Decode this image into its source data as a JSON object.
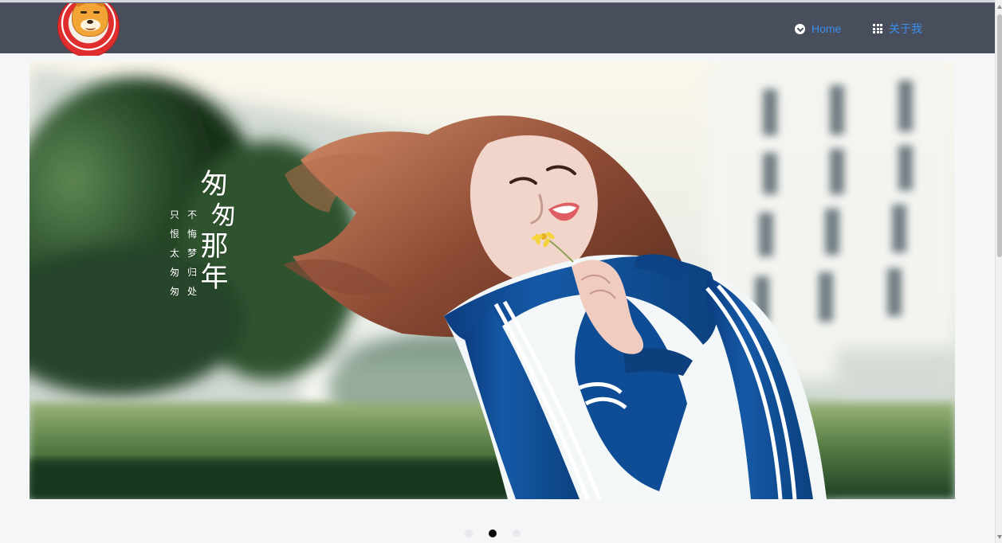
{
  "window": {
    "navbar_background": "#484e5c",
    "page_background": "#f5f6f8"
  },
  "brand": {
    "logo_icon": "shiba-dog-logo"
  },
  "navigation": [
    {
      "label": "Home",
      "icon": "home-icon"
    },
    {
      "label": "关于我",
      "icon": "grid-icon"
    }
  ],
  "hero": {
    "poem_title": [
      "匆",
      "匆",
      "那",
      "年"
    ],
    "poem_line_1": [
      "只",
      "恨",
      "太",
      "匆",
      "匆"
    ],
    "poem_line_2": [
      "不",
      "悔",
      "梦",
      "归",
      "处"
    ],
    "main_colors": {
      "jacket_blue": "#134f98",
      "background_green": "#426b3d",
      "sky": "#f7f4ea"
    }
  },
  "carousel": {
    "active_index": 2,
    "total": 3
  }
}
